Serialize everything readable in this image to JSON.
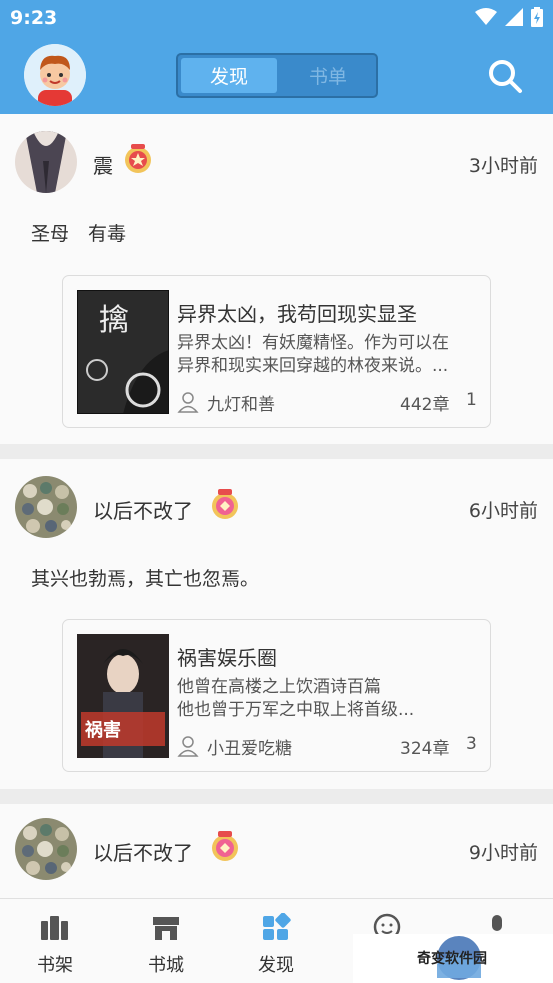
{
  "status": {
    "time": "9:23"
  },
  "header": {
    "tabs": [
      {
        "label": "发现",
        "active": true
      },
      {
        "label": "书单",
        "active": false
      }
    ],
    "accent": "#4fa6e6"
  },
  "posts": [
    {
      "user": "震",
      "time": "3小时前",
      "text": "圣母　有毒",
      "book": {
        "title": "异界太凶，我苟回现实显圣",
        "desc_line1": "异界太凶！有妖魔精怪。作为可以在",
        "desc_line2": "异界和现实来回穿越的林夜来说。...",
        "author": "九灯和善",
        "chapters": "442章",
        "count": "1",
        "cover_text": "擒 道"
      }
    },
    {
      "user": "以后不改了",
      "time": "6小时前",
      "text": "其兴也勃焉，其亡也忽焉。",
      "book": {
        "title": "祸害娱乐圈",
        "desc_line1": "他曾在高楼之上饮酒诗百篇",
        "desc_line2": "他也曾于万军之中取上将首级...",
        "author": "小丑爱吃糖",
        "chapters": "324章",
        "count": "3",
        "cover_text": "祸害娱乐圈"
      }
    },
    {
      "user": "以后不改了",
      "time": "9小时前"
    }
  ],
  "tabbar": {
    "items": [
      {
        "label": "书架",
        "icon": "bookshelf-icon"
      },
      {
        "label": "书城",
        "icon": "store-icon"
      },
      {
        "label": "发现",
        "icon": "discover-icon",
        "active": true
      },
      {
        "label": "",
        "icon": "community-icon"
      },
      {
        "label": "",
        "icon": "mine-icon"
      }
    ],
    "active_color": "#4fa6e6"
  },
  "watermark": {
    "text": "奇变软件园"
  }
}
